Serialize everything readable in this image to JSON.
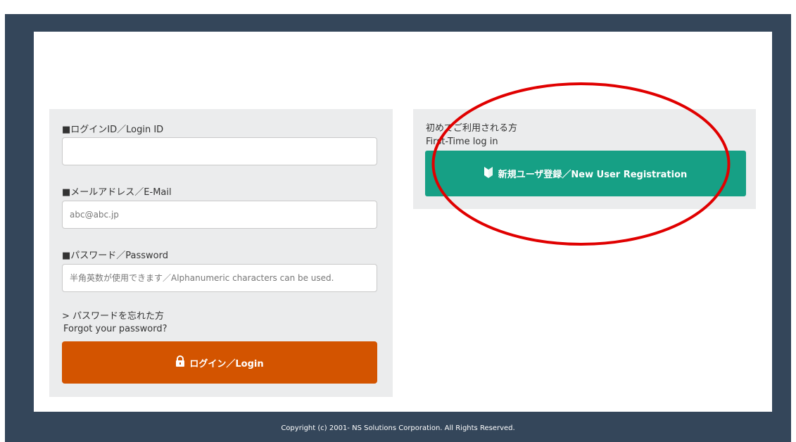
{
  "login": {
    "id_label": "■ログインID／Login ID",
    "id_value": "",
    "email_label": "■メールアドレス／E-Mail",
    "email_placeholder": "abc@abc.jp",
    "password_label": "■パスワード／Password",
    "password_placeholder": "半角英数が使用できます／Alphanumeric characters can be used.",
    "forgot_line1": "> パスワードを忘れた方",
    "forgot_line2": "Forgot your password?",
    "login_button": "ログイン／Login"
  },
  "registration": {
    "text_line1": "初めてご利用される方",
    "text_line2": "First-Time log in",
    "button": "新規ユーザ登録／New User Registration"
  },
  "footer": {
    "copyright": "Copyright (c) 2001- NS Solutions Corporation. All Rights Reserved."
  },
  "colors": {
    "frame": "#34465a",
    "login_button": "#d35400",
    "registration_button": "#16a085",
    "annotation": "#e00000"
  },
  "icons": {
    "login_button": "padlock-icon",
    "registration_button": "beginner-mark-icon"
  }
}
